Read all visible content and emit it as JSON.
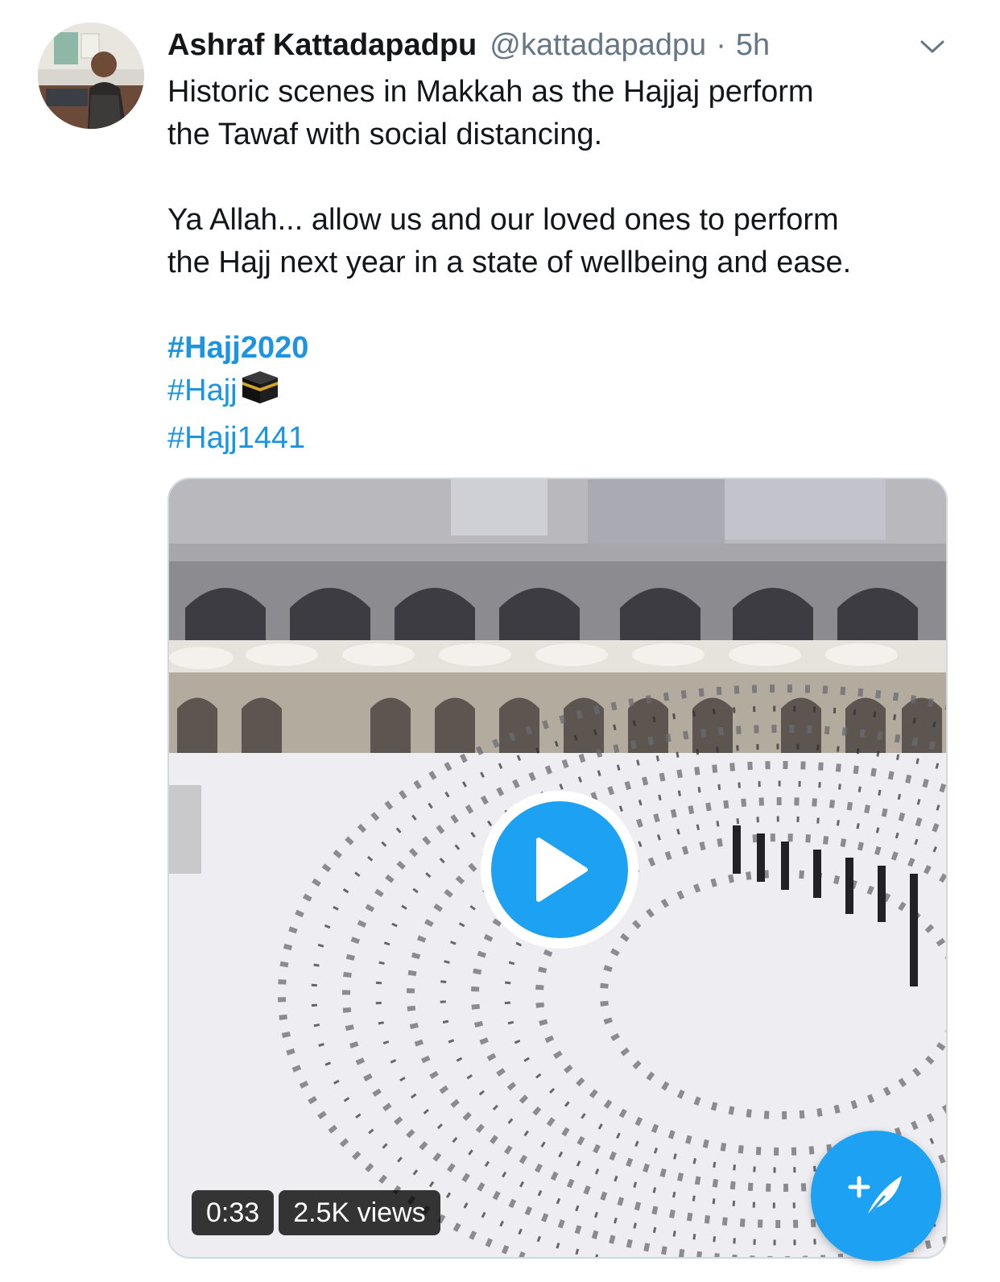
{
  "tweet": {
    "display_name": "Ashraf Kattadapadpu",
    "handle": "@kattadapadpu",
    "separator": "·",
    "time": "5h",
    "text_lines": [
      "Historic scenes in Makkah as the Hajjaj perform",
      "the Tawaf with social distancing.",
      "Ya Allah... allow us and our loved  ones to perform",
      "the Hajj next year in a state of wellbeing and ease."
    ],
    "hashtags": [
      "#Hajj2020",
      "#Hajj",
      "#Hajj1441"
    ]
  },
  "video": {
    "duration": "0:33",
    "views": "2.5K views"
  },
  "icons": {
    "more": "chevron-down-icon",
    "play": "play-icon",
    "compose": "compose-tweet-icon",
    "emoji": "kaaba-emoji"
  },
  "colors": {
    "link": "#1b95e0",
    "accent": "#1da1f2",
    "secondary_text": "#657786",
    "primary_text": "#14171a"
  }
}
